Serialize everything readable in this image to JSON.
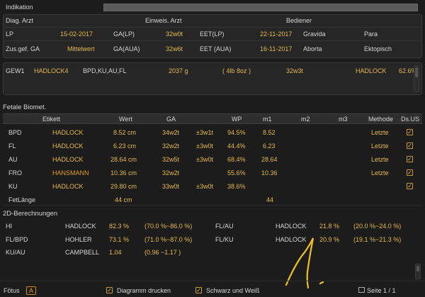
{
  "indication": {
    "label": "Indikation",
    "value": ""
  },
  "header": {
    "diag_arzt": "Diag. Arzt",
    "einweis_arzt": "Einweis. Arzt",
    "bediener": "Bediener",
    "lp_label": "LP",
    "lp_value": "15-02-2017",
    "ga_lp_label": "GA(LP)",
    "ga_lp_value": "32w0t",
    "eet_lp_label": "EET(LP)",
    "eet_lp_value": "22-11-2017",
    "gravida_label": "Gravida",
    "para_label": "Para",
    "zus_ga_label": "Zus.gef. GA",
    "zus_ga_value": "Mittelwert",
    "ga_aua_label": "GA(AUA)",
    "ga_aua_value": "32w6t",
    "eet_aua_label": "EET (AUA)",
    "eet_aua_value": "16-11-2017",
    "aborta_label": "Aborta",
    "ektopisch_label": "Ektopisch"
  },
  "weight": {
    "label": "GEW1",
    "method": "HADLOCK4",
    "params": "BPD,KU,AU,FL",
    "grams": "2037 g",
    "pounds": "( 4lb 8oz )",
    "ga": "32w3t",
    "ref": "HADLOCK",
    "percentile": "62.6%"
  },
  "biometry": {
    "title": "Fetale Biomet.",
    "columns": [
      "Etikett",
      "Wert",
      "GA",
      "WP",
      "m1",
      "m2",
      "m3",
      "Methode",
      "Ds.US"
    ],
    "rows": [
      {
        "name": "BPD",
        "method": "HADLOCK",
        "value": "8.52 cm",
        "ga": "34w2t",
        "sd": "±3w1t",
        "wp": "94.5%",
        "m1": "8.52",
        "methode": "Letzte",
        "checked": true
      },
      {
        "name": "FL",
        "method": "HADLOCK",
        "value": "6.23 cm",
        "ga": "32w2t",
        "sd": "±3w0t",
        "wp": "44.4%",
        "m1": "6.23",
        "methode": "Letzte",
        "checked": true
      },
      {
        "name": "AU",
        "method": "HADLOCK",
        "value": "28.64 cm",
        "ga": "32w5t",
        "sd": "±3w0t",
        "wp": "68.4%",
        "m1": "28.64",
        "methode": "Letzte",
        "checked": true
      },
      {
        "name": "FRO",
        "method": "HANSMANN",
        "value": "10.36 cm",
        "ga": "32w2t",
        "sd": "",
        "wp": "55.6%",
        "m1": "10.36",
        "methode": "Letzte",
        "checked": true
      },
      {
        "name": "KU",
        "method": "HADLOCK",
        "value": "29.80 cm",
        "ga": "33w0t",
        "sd": "±3w0t",
        "wp": "38.6%",
        "m1": "",
        "methode": "",
        "checked": true
      },
      {
        "name": "FetLänge",
        "method": "",
        "value": "44 cm",
        "ga": "",
        "sd": "",
        "wp": "",
        "m1": "44",
        "methode": "",
        "checked": false
      }
    ]
  },
  "calc2d": {
    "title": "2D-Berechnungen",
    "left": [
      {
        "name": "HI",
        "method": "HADLOCK",
        "value": "82.3 %",
        "range": "(70.0 %~86.0 %)"
      },
      {
        "name": "FL/BPD",
        "method": "HOHLER",
        "value": "73.1 %",
        "range": "(71.0 %~87.0 %)"
      },
      {
        "name": "KU/AU",
        "method": "CAMPBELL",
        "value": "1.04",
        "range": "(0.96 ~1.17 )"
      }
    ],
    "right": [
      {
        "name": "FL/AU",
        "method": "HADLOCK",
        "value": "21.8 %",
        "range": "(20.0 %~24.0 %)"
      },
      {
        "name": "FL/KU",
        "method": "HADLOCK",
        "value": "20.9 %",
        "range": "(19.1 %~21.3 %)"
      }
    ]
  },
  "footer": {
    "fetus_label": "Fötus",
    "fetus_value": "A",
    "print_chart": "Diagramm drucken",
    "bw": "Schwarz und Weiß",
    "page": "Seite 1 / 1"
  },
  "colors": {
    "accent": "#e6b94a",
    "background": "#1c1c1c"
  }
}
